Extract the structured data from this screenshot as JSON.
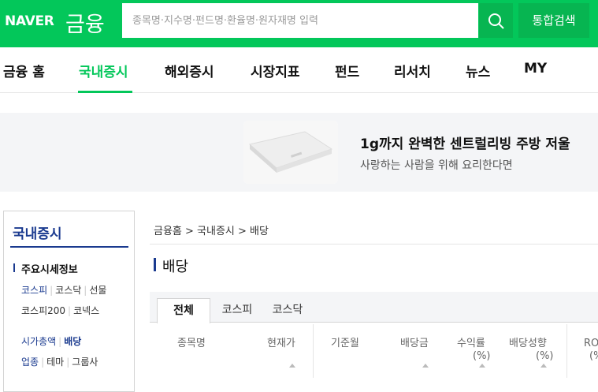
{
  "header": {
    "logo_naver": "NAVER",
    "logo_fin": "금융",
    "search_placeholder": "종목명·지수명·펀드명·환율명·원자재명 입력",
    "total_search_label": "통합검색",
    "accent_color": "#03c75a"
  },
  "nav": {
    "items": [
      "금융 홈",
      "국내증시",
      "해외증시",
      "시장지표",
      "펀드",
      "리서치",
      "뉴스",
      "MY"
    ],
    "active": "국내증시"
  },
  "banner": {
    "title": "1g까지 완벽한 센트럴리빙 주방 저울",
    "subtitle": "사랑하는 사람을 위해 요리한다면"
  },
  "sidebar": {
    "title": "국내증시",
    "section": "주요시세정보",
    "row1": [
      "코스피",
      "코스닥",
      "선물"
    ],
    "row2": [
      "코스피200",
      "코넥스"
    ],
    "row3": [
      "시가총액",
      "배당"
    ],
    "row4": [
      "업종",
      "테마",
      "그룹사"
    ]
  },
  "content": {
    "breadcrumb": "금융홈 > 국내증시 > 배당",
    "title": "배당",
    "tabs": [
      "전체",
      "코스피",
      "코스닥"
    ],
    "columns": [
      "종목명",
      "현재가",
      "기준월",
      "배당금",
      "수익률",
      "(%)",
      "배당성향",
      "(%)",
      "RO",
      "(%"
    ]
  }
}
